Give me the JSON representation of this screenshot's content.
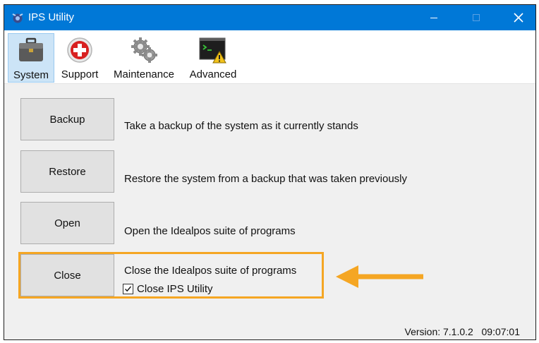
{
  "window": {
    "title": "IPS Utility"
  },
  "toolbar": {
    "tabs": [
      {
        "label": "System",
        "icon": "briefcase-icon",
        "active": true
      },
      {
        "label": "Support",
        "icon": "red-cross-icon"
      },
      {
        "label": "Maintenance",
        "icon": "gears-icon"
      },
      {
        "label": "Advanced",
        "icon": "terminal-warning-icon"
      }
    ]
  },
  "actions": [
    {
      "button": "Backup",
      "description": "Take a backup of the system as it currently stands"
    },
    {
      "button": "Restore",
      "description": "Restore the system from a backup that was taken previously"
    },
    {
      "button": "Open",
      "description": "Open the Idealpos suite of programs"
    },
    {
      "button": "Close",
      "description": "Close the Idealpos suite of programs"
    }
  ],
  "close_option": {
    "label": "Close IPS Utility",
    "checked": true
  },
  "status": {
    "version": "Version: 7.1.0.2",
    "time": "09:07:01"
  },
  "colors": {
    "titlebar": "#0078d7",
    "highlight": "#f5a623",
    "active_tab": "#cce4f7"
  }
}
